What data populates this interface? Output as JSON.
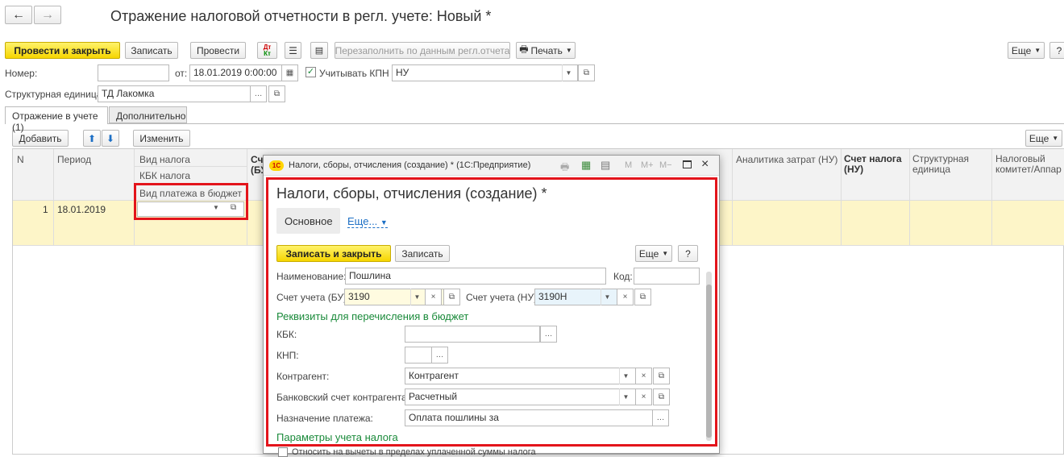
{
  "nav": {
    "back": "←",
    "forward": "→"
  },
  "window_title": "Отражение налоговой отчетности в регл. учете: Новый *",
  "toolbar": {
    "post_close": "Провести и закрыть",
    "save": "Записать",
    "post": "Провести",
    "refill": "Перезаполнить по данным регл.отчета",
    "print": "Печать",
    "more": "Еще",
    "help": "?"
  },
  "header": {
    "number_label": "Номер:",
    "number_value": "",
    "date_label": "от:",
    "date_value": "18.01.2019  0:00:00",
    "kpn_label": "Учитывать КПН",
    "kpn_checked": true,
    "mode_value": "НУ",
    "unit_label": "Структурная единица:",
    "unit_value": "ТД Лакомка"
  },
  "tabs": [
    {
      "label": "Отражение в учете (1)"
    },
    {
      "label": "Дополнительно"
    }
  ],
  "table_toolbar": {
    "add": "Добавить",
    "change": "Изменить",
    "more": "Еще"
  },
  "table": {
    "columns": {
      "n": "N",
      "period": "Период",
      "tax_type": "Вид налога",
      "kbk": "КБК налога",
      "payment_type": "Вид платежа в бюджет",
      "acc_bu_short": "Сче",
      "acc_bu_short2": "(БУ",
      "analytics": "Аналитика затрат (НУ)",
      "tax_account": "Счет налога (НУ)",
      "unit": "Структурная единица",
      "committee": "Налоговый комитет/Аппар"
    },
    "rows": [
      {
        "n": "1",
        "period": "18.01.2019"
      }
    ]
  },
  "dialog": {
    "title_bar": "Налоги, сборы, отчисления (создание) *  (1С:Предприятие)",
    "logo": "1С",
    "heading": "Налоги, сборы, отчисления (создание) *",
    "tab_main": "Основное",
    "tab_more": "Еще...",
    "save_close": "Записать и закрыть",
    "save": "Записать",
    "more": "Еще",
    "help": "?",
    "name_label": "Наименование:",
    "name_value": "Пошлина",
    "code_label": "Код:",
    "code_value": "",
    "acc_bu_label": "Счет учета (БУ):",
    "acc_bu_value": "3190",
    "acc_nu_label": "Счет учета (НУ):",
    "acc_nu_value": "3190Н",
    "budget_section": "Реквизиты для перечисления в бюджет",
    "kbk_label": "КБК:",
    "kbk_value": "",
    "knp_label": "КНП:",
    "knp_value": "",
    "counterparty_label": "Контрагент:",
    "counterparty_value": "Контрагент",
    "bank_label": "Банковский счет контрагента:",
    "bank_value": "Расчетный",
    "purpose_label": "Назначение платежа:",
    "purpose_value": "Оплата пошлины за",
    "params_section": "Параметры учета налога",
    "deduct_label": "Относить на вычеты в пределах уплаченной суммы налога",
    "icons": {
      "m": "M",
      "mplus": "M+",
      "mminus": "M−"
    }
  },
  "colors": {
    "accent_red": "#e3141b",
    "row_yellow": "#fdf5c8",
    "section_green": "#1a8a3a",
    "button_yellow": "#f6d500"
  }
}
